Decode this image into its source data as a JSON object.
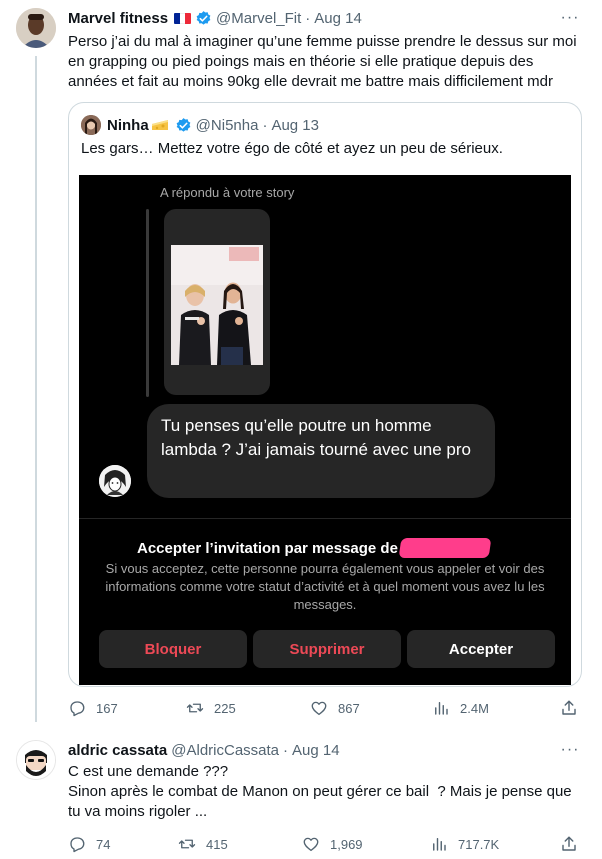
{
  "tweet1": {
    "display_name": "Marvel fitness",
    "handle": "@Marvel_Fit",
    "separator": "·",
    "date": "Aug 14",
    "more": "···",
    "text": "Perso j’ai du mal à imaginer qu’une femme puisse prendre le dessus sur moi\nen grapping ou pied poings mais en théorie si elle pratique depuis des\nannées et fait au moins 90kg elle devrait me battre mais difficilement mdr",
    "quote": {
      "display_name": "Ninha",
      "handle": "@Ni5nha",
      "separator": "·",
      "date": "Aug 13",
      "text": "Les gars… Mettez votre égo de côté et ayez un peu de sérieux.",
      "dm": {
        "replied_label": "A répondu à votre story",
        "message": "Tu penses qu’elle poutre un homme lambda ? J’ai jamais tourné avec une pro",
        "invite_title": "Accepter l’invitation par message de",
        "invite_desc": "Si vous acceptez, cette personne pourra également vous appeler et voir des informations comme votre statut d’activité et à quel moment vous avez lu les messages.",
        "block_label": "Bloquer",
        "delete_label": "Supprimer",
        "accept_label": "Accepter"
      }
    },
    "stats": {
      "replies": "167",
      "reposts": "225",
      "likes": "867",
      "views": "2.4M"
    }
  },
  "tweet2": {
    "display_name": "aldric cassata",
    "handle": "@AldricCassata",
    "separator": "·",
    "date": "Aug 14",
    "more": "···",
    "text": "C est une demande ???\nSinon après le combat de Manon on peut gérer ce bail  ? Mais je pense que\ntu va moins rigoler ...",
    "stats": {
      "replies": "74",
      "reposts": "415",
      "likes": "1,969",
      "views": "717.7K"
    }
  },
  "colors": {
    "accent": "#1d9bf0",
    "muted": "#536471",
    "danger": "#ed4956",
    "redaction": "#ff3d8b"
  },
  "icons": [
    "reply-icon",
    "repost-icon",
    "like-icon",
    "views-icon",
    "share-icon",
    "verified-badge-icon",
    "french-flag-icon",
    "cheese-emoji-icon"
  ]
}
